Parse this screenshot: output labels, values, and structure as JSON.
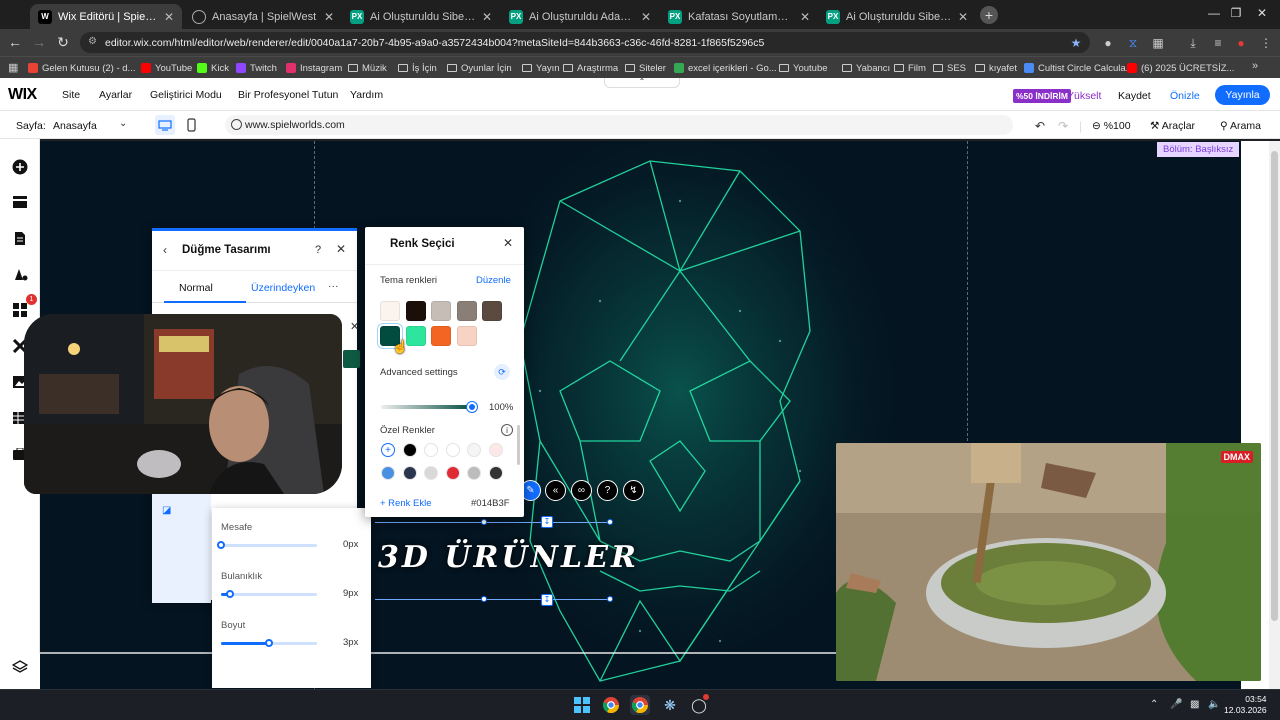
{
  "browser": {
    "tabs": [
      {
        "title": "Wix Editörü | SpielWest",
        "favicon": "W",
        "color": "#000000",
        "active": true
      },
      {
        "title": "Anasayfa | SpielWest",
        "favicon": "",
        "color": "#e0e0e0"
      },
      {
        "title": "Ai Oluşturuldu Siberpunk Şehir",
        "favicon": "PX",
        "color": "#05a081"
      },
      {
        "title": "Ai Oluşturuldu Adam Binalar -",
        "favicon": "PX",
        "color": "#05a081"
      },
      {
        "title": "Kafatası Soyutlama Neon Işık -",
        "favicon": "PX",
        "color": "#05a081"
      },
      {
        "title": "Ai Oluşturuldu Siber Neon Gec",
        "favicon": "PX",
        "color": "#05a081"
      }
    ],
    "new_tab": "+",
    "url": "editor.wix.com/html/editor/web/renderer/edit/0040a1a7-20b7-4b95-a9a0-a3572434b004?metaSiteId=844b3663-c36c-46fd-8281-1f865f5296c5",
    "bookmarks": [
      {
        "label": "Gelen Kutusu (2) - d...",
        "icon": "mail",
        "color": "#ea4335"
      },
      {
        "label": "YouTube",
        "icon": "youtube",
        "color": "#ff0000"
      },
      {
        "label": "Kick",
        "icon": "kick",
        "color": "#53fc18"
      },
      {
        "label": "Twitch",
        "icon": "twitch",
        "color": "#9146ff"
      },
      {
        "label": "Instagram",
        "icon": "instagram",
        "color": "#e1306c"
      },
      {
        "label": "Müzik",
        "icon": "folder"
      },
      {
        "label": "İş İçin",
        "icon": "folder"
      },
      {
        "label": "Oyunlar İçin",
        "icon": "folder"
      },
      {
        "label": "Yayın",
        "icon": "folder"
      },
      {
        "label": "Araştırma",
        "icon": "folder"
      },
      {
        "label": "Siteler",
        "icon": "folder"
      },
      {
        "label": "excel içerikleri - Go...",
        "icon": "sheets",
        "color": "#34a853"
      },
      {
        "label": "Youtube",
        "icon": "folder"
      },
      {
        "label": "Yabancı",
        "icon": "folder"
      },
      {
        "label": "Film",
        "icon": "folder"
      },
      {
        "label": "SES",
        "icon": "folder"
      },
      {
        "label": "kıyafet",
        "icon": "folder"
      },
      {
        "label": "Cultist Circle Calcula...",
        "icon": "link",
        "color": "#4b8bf4"
      },
      {
        "label": "(6) 2025 ÜCRETSİZ...",
        "icon": "youtube",
        "color": "#ff0000"
      }
    ]
  },
  "wix": {
    "logo": "WIX",
    "menu": [
      "Site",
      "Ayarlar",
      "Geliştirici Modu",
      "Bir Profesyonel Tutun",
      "Yardım"
    ],
    "sale_badge": "%50 İNDİRİM",
    "upgrade": "Yükselt",
    "save": "Kaydet",
    "preview": "Önizle",
    "publish": "Yayınla",
    "page_label": "Sayfa:",
    "page_value": "Anasayfa",
    "site_url": "www.spielworlds.com",
    "zoom": "%100",
    "tools": "Araçlar",
    "search": "Arama",
    "section_label": "Bölüm: Başlıksız",
    "rail_badge": "1"
  },
  "canvas": {
    "heading": "3D ÜRÜNLER"
  },
  "design_panel": {
    "title": "Düğme Tasarımı",
    "help": "?",
    "tabs": [
      "Normal",
      "Üzerindeyken"
    ],
    "more": "···"
  },
  "shadow_panel": {
    "sliders": [
      {
        "label": "Mesafe",
        "value": "0px",
        "level": 0.0
      },
      {
        "label": "Bulanıklık",
        "value": "9px",
        "level": 0.09
      },
      {
        "label": "Boyut",
        "value": "3px",
        "level": 0.5
      }
    ]
  },
  "color_picker": {
    "title": "Renk Seçici",
    "theme_label": "Tema renkleri",
    "edit": "Düzenle",
    "theme_colors": [
      "#fbf3ee",
      "#1b0f0a",
      "#c5bdb6",
      "#8a7f76",
      "#5a4a40",
      "#014B3F",
      "#2ee59d",
      "#f26522",
      "#f8d3c3"
    ],
    "selected_index": 5,
    "advanced": "Advanced settings",
    "opacity": "100%",
    "custom_label": "Özel Renkler",
    "custom_colors": [
      "add",
      "#000000",
      "#ffffff",
      "#ffffff",
      "#f5f5f5",
      "#fde8e8",
      "#4a90e2",
      "#2c3550",
      "#d9d9d9",
      "#e02b35",
      "#bcbcbc",
      "#333333"
    ],
    "add_color": "+ Renk Ekle",
    "hex": "#014B3F"
  },
  "video": {
    "badge": "DMAX"
  },
  "taskbar": {
    "time": "03:54",
    "date": "12.03.2026"
  }
}
